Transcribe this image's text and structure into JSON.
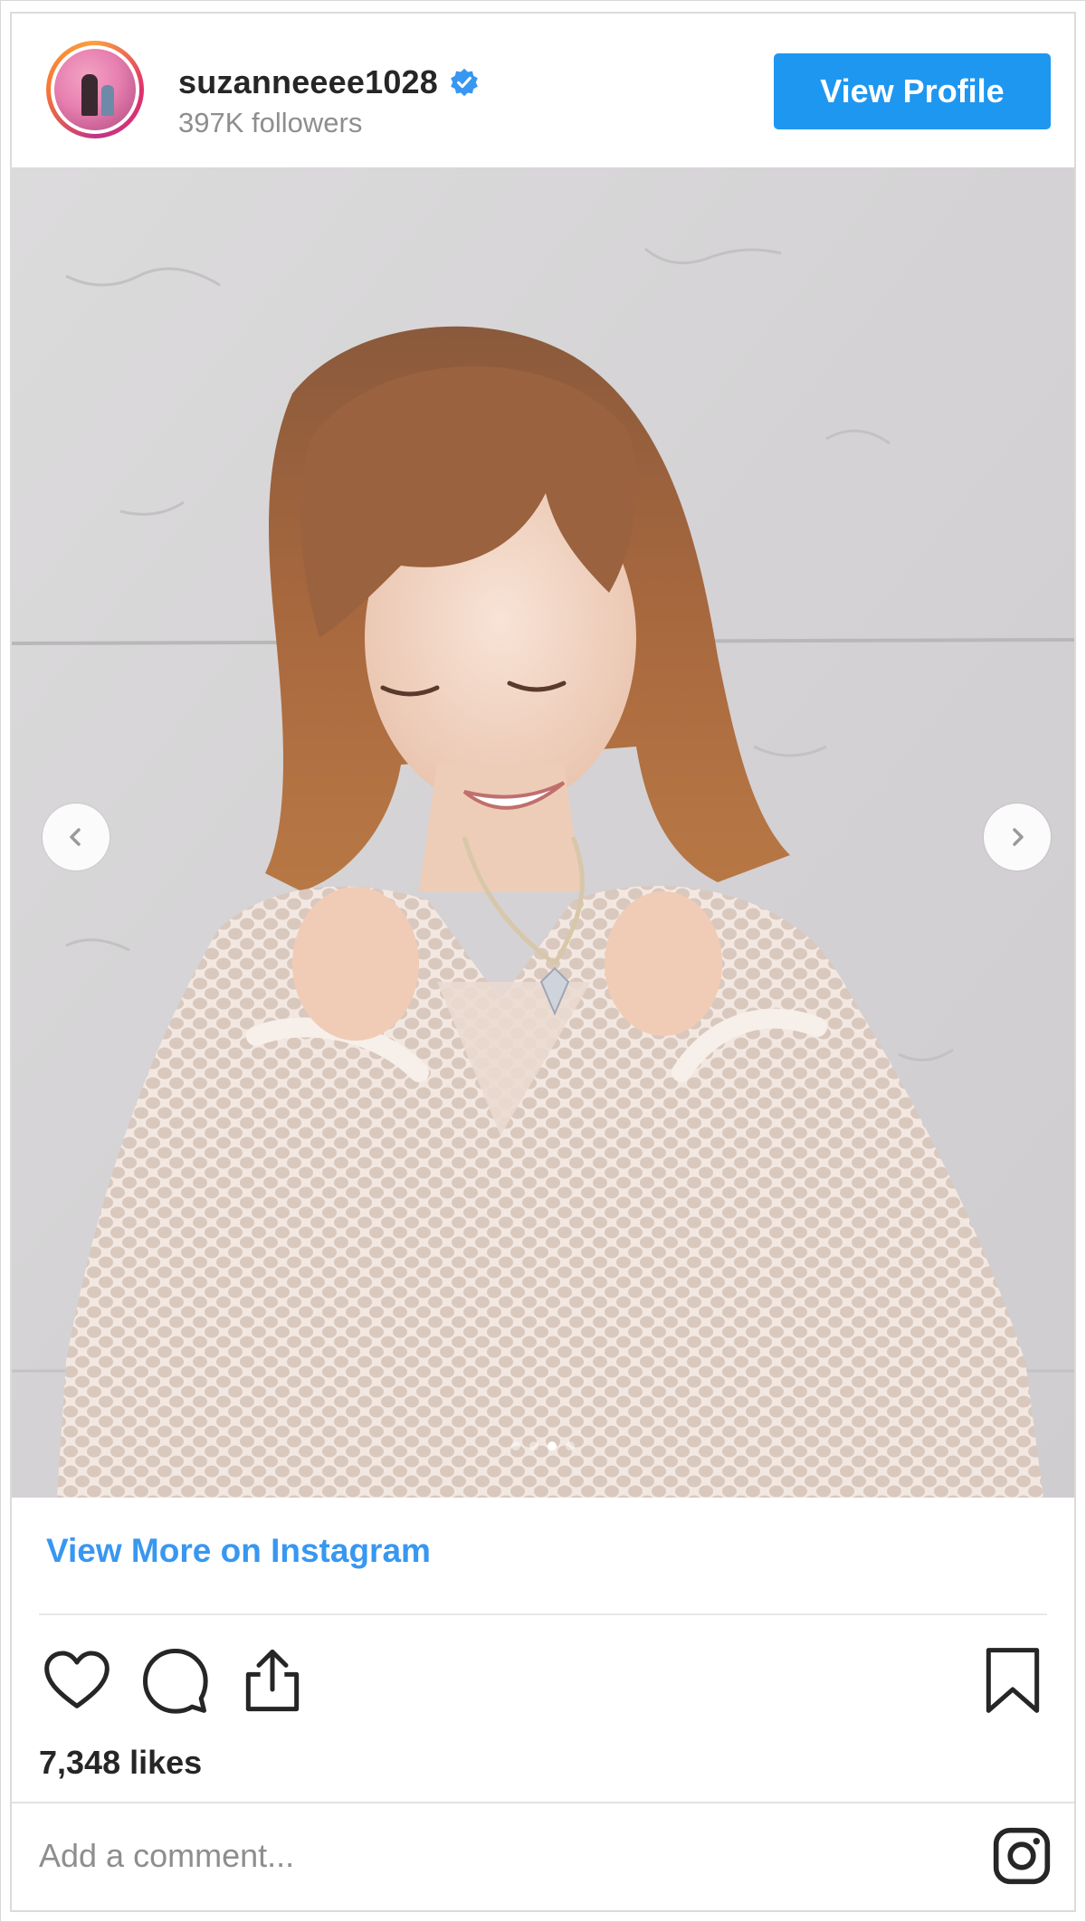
{
  "header": {
    "username": "suzanneeee1028",
    "verified_icon": "verified-badge-icon",
    "followers": "397K followers",
    "view_profile_label": "View Profile",
    "accent_color": "#1e97f0"
  },
  "photo": {
    "prev_icon": "chevron-left-icon",
    "next_icon": "chevron-right-icon",
    "carousel": {
      "count": 4,
      "active_index": 2
    }
  },
  "footer": {
    "view_more_label": "View More on Instagram",
    "link_color": "#3897f0",
    "actions": [
      "heart-icon",
      "comment-icon",
      "share-icon",
      "bookmark-icon"
    ],
    "likes": "7,348 likes",
    "comment_placeholder": "Add a comment...",
    "logo_icon": "instagram-logo-icon"
  }
}
